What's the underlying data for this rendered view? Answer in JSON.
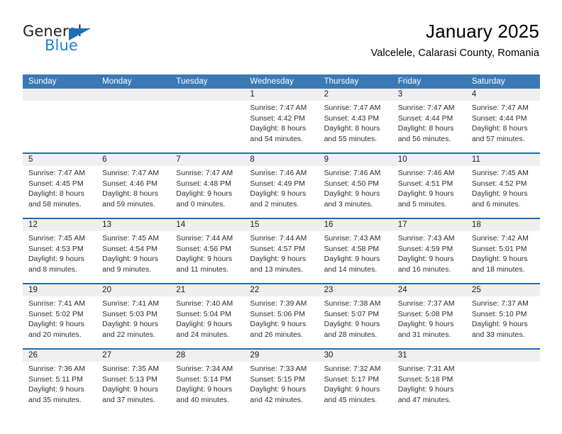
{
  "brand": {
    "name_top": "General",
    "name_bottom": "Blue",
    "triangle_icon": "brand-triangle-icon",
    "color_blue": "#1b7fd4",
    "color_triangle": "#1b6fb8"
  },
  "header": {
    "title": "January 2025",
    "subtitle": "Valcelele, Calarasi County, Romania"
  },
  "theme": {
    "header_blue": "#3b79b6",
    "row_divider_blue": "#1f6cb0",
    "daynum_band": "#efefef",
    "text": "#2b2b2b"
  },
  "weekdays": [
    "Sunday",
    "Monday",
    "Tuesday",
    "Wednesday",
    "Thursday",
    "Friday",
    "Saturday"
  ],
  "weeks": [
    [
      {
        "day": "",
        "empty": true,
        "sunrise": "",
        "sunset": "",
        "daylight1": "",
        "daylight2": ""
      },
      {
        "day": "",
        "empty": true,
        "sunrise": "",
        "sunset": "",
        "daylight1": "",
        "daylight2": ""
      },
      {
        "day": "",
        "empty": true,
        "sunrise": "",
        "sunset": "",
        "daylight1": "",
        "daylight2": ""
      },
      {
        "day": "1",
        "sunrise": "Sunrise: 7:47 AM",
        "sunset": "Sunset: 4:42 PM",
        "daylight1": "Daylight: 8 hours",
        "daylight2": "and 54 minutes."
      },
      {
        "day": "2",
        "sunrise": "Sunrise: 7:47 AM",
        "sunset": "Sunset: 4:43 PM",
        "daylight1": "Daylight: 8 hours",
        "daylight2": "and 55 minutes."
      },
      {
        "day": "3",
        "sunrise": "Sunrise: 7:47 AM",
        "sunset": "Sunset: 4:44 PM",
        "daylight1": "Daylight: 8 hours",
        "daylight2": "and 56 minutes."
      },
      {
        "day": "4",
        "sunrise": "Sunrise: 7:47 AM",
        "sunset": "Sunset: 4:44 PM",
        "daylight1": "Daylight: 8 hours",
        "daylight2": "and 57 minutes."
      }
    ],
    [
      {
        "day": "5",
        "sunrise": "Sunrise: 7:47 AM",
        "sunset": "Sunset: 4:45 PM",
        "daylight1": "Daylight: 8 hours",
        "daylight2": "and 58 minutes."
      },
      {
        "day": "6",
        "sunrise": "Sunrise: 7:47 AM",
        "sunset": "Sunset: 4:46 PM",
        "daylight1": "Daylight: 8 hours",
        "daylight2": "and 59 minutes."
      },
      {
        "day": "7",
        "sunrise": "Sunrise: 7:47 AM",
        "sunset": "Sunset: 4:48 PM",
        "daylight1": "Daylight: 9 hours",
        "daylight2": "and 0 minutes."
      },
      {
        "day": "8",
        "sunrise": "Sunrise: 7:46 AM",
        "sunset": "Sunset: 4:49 PM",
        "daylight1": "Daylight: 9 hours",
        "daylight2": "and 2 minutes."
      },
      {
        "day": "9",
        "sunrise": "Sunrise: 7:46 AM",
        "sunset": "Sunset: 4:50 PM",
        "daylight1": "Daylight: 9 hours",
        "daylight2": "and 3 minutes."
      },
      {
        "day": "10",
        "sunrise": "Sunrise: 7:46 AM",
        "sunset": "Sunset: 4:51 PM",
        "daylight1": "Daylight: 9 hours",
        "daylight2": "and 5 minutes."
      },
      {
        "day": "11",
        "sunrise": "Sunrise: 7:45 AM",
        "sunset": "Sunset: 4:52 PM",
        "daylight1": "Daylight: 9 hours",
        "daylight2": "and 6 minutes."
      }
    ],
    [
      {
        "day": "12",
        "sunrise": "Sunrise: 7:45 AM",
        "sunset": "Sunset: 4:53 PM",
        "daylight1": "Daylight: 9 hours",
        "daylight2": "and 8 minutes."
      },
      {
        "day": "13",
        "sunrise": "Sunrise: 7:45 AM",
        "sunset": "Sunset: 4:54 PM",
        "daylight1": "Daylight: 9 hours",
        "daylight2": "and 9 minutes."
      },
      {
        "day": "14",
        "sunrise": "Sunrise: 7:44 AM",
        "sunset": "Sunset: 4:56 PM",
        "daylight1": "Daylight: 9 hours",
        "daylight2": "and 11 minutes."
      },
      {
        "day": "15",
        "sunrise": "Sunrise: 7:44 AM",
        "sunset": "Sunset: 4:57 PM",
        "daylight1": "Daylight: 9 hours",
        "daylight2": "and 13 minutes."
      },
      {
        "day": "16",
        "sunrise": "Sunrise: 7:43 AM",
        "sunset": "Sunset: 4:58 PM",
        "daylight1": "Daylight: 9 hours",
        "daylight2": "and 14 minutes."
      },
      {
        "day": "17",
        "sunrise": "Sunrise: 7:43 AM",
        "sunset": "Sunset: 4:59 PM",
        "daylight1": "Daylight: 9 hours",
        "daylight2": "and 16 minutes."
      },
      {
        "day": "18",
        "sunrise": "Sunrise: 7:42 AM",
        "sunset": "Sunset: 5:01 PM",
        "daylight1": "Daylight: 9 hours",
        "daylight2": "and 18 minutes."
      }
    ],
    [
      {
        "day": "19",
        "sunrise": "Sunrise: 7:41 AM",
        "sunset": "Sunset: 5:02 PM",
        "daylight1": "Daylight: 9 hours",
        "daylight2": "and 20 minutes."
      },
      {
        "day": "20",
        "sunrise": "Sunrise: 7:41 AM",
        "sunset": "Sunset: 5:03 PM",
        "daylight1": "Daylight: 9 hours",
        "daylight2": "and 22 minutes."
      },
      {
        "day": "21",
        "sunrise": "Sunrise: 7:40 AM",
        "sunset": "Sunset: 5:04 PM",
        "daylight1": "Daylight: 9 hours",
        "daylight2": "and 24 minutes."
      },
      {
        "day": "22",
        "sunrise": "Sunrise: 7:39 AM",
        "sunset": "Sunset: 5:06 PM",
        "daylight1": "Daylight: 9 hours",
        "daylight2": "and 26 minutes."
      },
      {
        "day": "23",
        "sunrise": "Sunrise: 7:38 AM",
        "sunset": "Sunset: 5:07 PM",
        "daylight1": "Daylight: 9 hours",
        "daylight2": "and 28 minutes."
      },
      {
        "day": "24",
        "sunrise": "Sunrise: 7:37 AM",
        "sunset": "Sunset: 5:08 PM",
        "daylight1": "Daylight: 9 hours",
        "daylight2": "and 31 minutes."
      },
      {
        "day": "25",
        "sunrise": "Sunrise: 7:37 AM",
        "sunset": "Sunset: 5:10 PM",
        "daylight1": "Daylight: 9 hours",
        "daylight2": "and 33 minutes."
      }
    ],
    [
      {
        "day": "26",
        "sunrise": "Sunrise: 7:36 AM",
        "sunset": "Sunset: 5:11 PM",
        "daylight1": "Daylight: 9 hours",
        "daylight2": "and 35 minutes."
      },
      {
        "day": "27",
        "sunrise": "Sunrise: 7:35 AM",
        "sunset": "Sunset: 5:13 PM",
        "daylight1": "Daylight: 9 hours",
        "daylight2": "and 37 minutes."
      },
      {
        "day": "28",
        "sunrise": "Sunrise: 7:34 AM",
        "sunset": "Sunset: 5:14 PM",
        "daylight1": "Daylight: 9 hours",
        "daylight2": "and 40 minutes."
      },
      {
        "day": "29",
        "sunrise": "Sunrise: 7:33 AM",
        "sunset": "Sunset: 5:15 PM",
        "daylight1": "Daylight: 9 hours",
        "daylight2": "and 42 minutes."
      },
      {
        "day": "30",
        "sunrise": "Sunrise: 7:32 AM",
        "sunset": "Sunset: 5:17 PM",
        "daylight1": "Daylight: 9 hours",
        "daylight2": "and 45 minutes."
      },
      {
        "day": "31",
        "sunrise": "Sunrise: 7:31 AM",
        "sunset": "Sunset: 5:18 PM",
        "daylight1": "Daylight: 9 hours",
        "daylight2": "and 47 minutes."
      },
      {
        "day": "",
        "empty": true,
        "sunrise": "",
        "sunset": "",
        "daylight1": "",
        "daylight2": ""
      }
    ]
  ]
}
